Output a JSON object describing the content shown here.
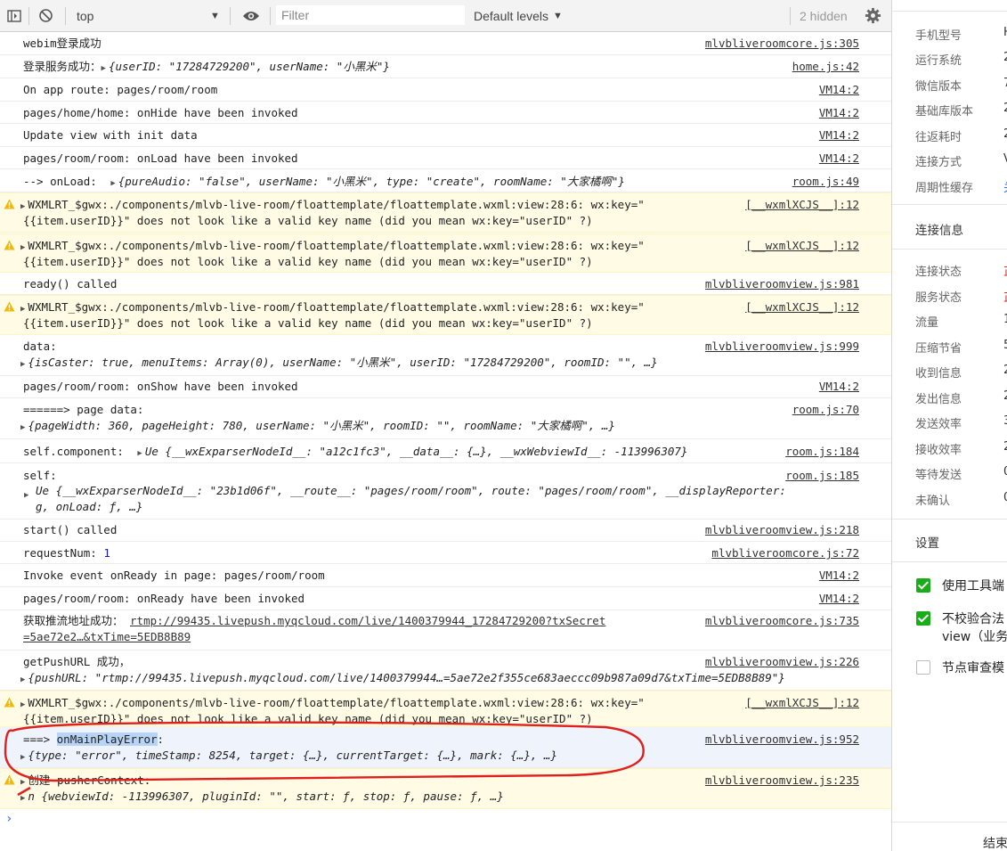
{
  "toolbar": {
    "context": "top",
    "filter_placeholder": "Filter",
    "levels": "Default levels",
    "hidden": "2 hidden"
  },
  "entries": [
    {
      "msg": "webim登录成功",
      "src": "mlvbliveroomcore.js:305"
    },
    {
      "msg_prefix": "登录服务成功：",
      "obj": "{userID: \"17284729200\", userName: \"小黑米\"}",
      "src": "home.js:42"
    },
    {
      "msg": "On app route: pages/room/room",
      "src": "VM14:2"
    },
    {
      "msg": "pages/home/home: onHide have been invoked",
      "src": "VM14:2"
    },
    {
      "msg": "Update view with init data",
      "src": "VM14:2"
    },
    {
      "msg": "pages/room/room: onLoad have been invoked",
      "src": "VM14:2"
    },
    {
      "msg_prefix": "--> onLoad: ",
      "obj": "{pureAudio: \"false\", userName: \"小黑米\", type: \"create\", roomName: \"大家橘啊\"}",
      "src": "room.js:49"
    },
    {
      "line1": "WXMLRT_$gwx:./components/mlvb-live-room/floattemplate/floattemplate.wxml:view:28:6: wx:key=\"",
      "line2": "{{item.userID}}\" does not look like a valid key name (did you mean wx:key=\"userID\" ?)",
      "src": "[__wxmlXCJS__]:12"
    },
    {
      "line1": "WXMLRT_$gwx:./components/mlvb-live-room/floattemplate/floattemplate.wxml:view:28:6: wx:key=\"",
      "line2": "{{item.userID}}\" does not look like a valid key name (did you mean wx:key=\"userID\" ?)",
      "src": "[__wxmlXCJS__]:12"
    },
    {
      "msg": "ready() called",
      "src": "mlvbliveroomview.js:981"
    },
    {
      "line1": "WXMLRT_$gwx:./components/mlvb-live-room/floattemplate/floattemplate.wxml:view:28:6: wx:key=\"",
      "line2": "{{item.userID}}\" does not look like a valid key name (did you mean wx:key=\"userID\" ?)",
      "src": "[__wxmlXCJS__]:12"
    },
    {
      "msg": "data:",
      "obj": "{isCaster: true, menuItems: Array(0), userName: \"小黑米\", userID: \"17284729200\", roomID: \"\", …}",
      "src": "mlvbliveroomview.js:999"
    },
    {
      "msg": "pages/room/room: onShow have been invoked",
      "src": "VM14:2"
    },
    {
      "msg": "======> page data:",
      "obj": "{pageWidth: 360, pageHeight: 780, userName: \"小黑米\", roomID: \"\", roomName: \"大家橘啊\", …}",
      "src": "room.js:70"
    },
    {
      "msg_prefix": "self.component: ",
      "obj": "Ue {__wxExparserNodeId__: \"a12c1fc3\", __data__: {…}, __wxWebviewId__: -113996307}",
      "src": "room.js:184"
    },
    {
      "msg": "self:",
      "obj": "Ue {__wxExparserNodeId__: \"23b1d06f\", __route__: \"pages/room/room\", route: \"pages/room/room\", __displayReporter:",
      "obj2": "g, onLoad: ƒ, …}",
      "src": "room.js:185"
    },
    {
      "msg": "start() called",
      "src": "mlvbliveroomview.js:218"
    },
    {
      "msg_prefix": "requestNum: ",
      "num": "1",
      "src": "mlvbliveroomcore.js:72"
    },
    {
      "msg": "Invoke event onReady in page: pages/room/room",
      "src": "VM14:2"
    },
    {
      "msg": "pages/room/room: onReady have been invoked",
      "src": "VM14:2"
    },
    {
      "msg_prefix": "获取推流地址成功： ",
      "link1": "rtmp://99435.livepush.myqcloud.com/live/1400379944_17284729200?txSecret",
      "link2": "=5ae72e2…&txTime=5EDB8B89",
      "src": "mlvbliveroomcore.js:735"
    },
    {
      "msg": "getPushURL 成功，",
      "obj": "{pushURL: \"rtmp://99435.livepush.myqcloud.com/live/1400379944…=5ae72e2f355ce683aeccc09b987a09d7&txTime=5EDB8B89\"}",
      "src": "mlvbliveroomview.js:226"
    },
    {
      "line1": "WXMLRT_$gwx:./components/mlvb-live-room/floattemplate/floattemplate.wxml:view:28:6: wx:key=\"",
      "line2": "{{item.userID}}\" does not look like a valid key name (did you mean wx:key=\"userID\" ?)",
      "src": "[__wxmlXCJS__]:12"
    },
    {
      "msg_prefix": "===> ",
      "msg_hl": "onMainPlayError",
      "msg_suffix": ":",
      "obj": "{type: \"error\", timeStamp: 8254, target: {…}, currentTarget: {…}, mark: {…}, …}",
      "src": "mlvbliveroomview.js:952"
    },
    {
      "msg": "创建 pusherContext:",
      "obj": "n {webviewId: -113996307, pluginId: \"\", start: ƒ, stop: ƒ, pause: ƒ, …}",
      "src": "mlvbliveroomview.js:235"
    }
  ],
  "panel": {
    "rows": [
      {
        "label": "手机型号",
        "value": "H"
      },
      {
        "label": "运行系统",
        "value": "2"
      },
      {
        "label": "微信版本",
        "value": "7"
      },
      {
        "label": "基础库版本",
        "value": "2"
      },
      {
        "label": "往返耗时",
        "value": "2"
      },
      {
        "label": "连接方式",
        "value": "V"
      },
      {
        "label": "周期性缓存",
        "value": "关"
      }
    ],
    "section_conn": "连接信息",
    "conn_rows": [
      {
        "label": "连接状态",
        "value": "正"
      },
      {
        "label": "服务状态",
        "value": "正"
      },
      {
        "label": "流量",
        "value": "1"
      },
      {
        "label": "压缩节省",
        "value": "5"
      },
      {
        "label": "收到信息",
        "value": "2"
      },
      {
        "label": "发出信息",
        "value": "2"
      },
      {
        "label": "发送效率",
        "value": "3"
      },
      {
        "label": "接收效率",
        "value": "2"
      },
      {
        "label": "等待发送",
        "value": "0"
      },
      {
        "label": "未确认",
        "value": "0"
      }
    ],
    "section_settings": "设置",
    "checks": [
      {
        "label": "使用工具端",
        "checked": true
      },
      {
        "label": "不校验合法",
        "label2": "view（业务",
        "checked": true
      },
      {
        "label": "节点审查模",
        "checked": false
      }
    ],
    "footer": "结束"
  },
  "colors": {
    "accent": "#1aad19",
    "warning_bg": "#fffbe5",
    "annotation": "#e0201e"
  }
}
